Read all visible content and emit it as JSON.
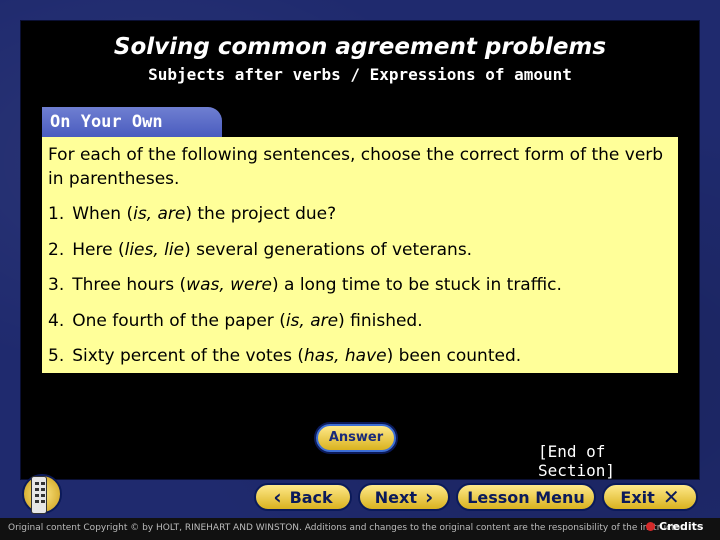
{
  "title": "Solving common agreement problems",
  "subtitle": "Subjects after verbs / Expressions of amount",
  "tab_label": "On Your Own",
  "instructions": "For each of the following sentences, choose the correct form of the verb in parentheses.",
  "items": [
    {
      "num": "1.",
      "before": "When (",
      "choices": "is, are",
      "after": ") the project due?"
    },
    {
      "num": "2.",
      "before": "Here (",
      "choices": "lies, lie",
      "after": ") several generations of veterans."
    },
    {
      "num": "3.",
      "before": "Three hours (",
      "choices": "was, were",
      "after": ") a long time to be stuck in traffic."
    },
    {
      "num": "4.",
      "before": "One fourth of the paper (",
      "choices": "is, are",
      "after": ") finished."
    },
    {
      "num": "5.",
      "before": "Sixty percent of the votes (",
      "choices": "has, have",
      "after": ") been counted."
    }
  ],
  "answer_label": "Answer",
  "end_section": "[End of Section]",
  "nav": {
    "back": "Back",
    "next": "Next",
    "lesson_menu": "Lesson Menu",
    "exit": "Exit"
  },
  "footer": {
    "copyright": "Original content Copyright © by HOLT, RINEHART AND WINSTON. Additions and changes to the original content are the responsibility of the instructor.",
    "credits": "Credits"
  },
  "colors": {
    "background": "#1f2a6e",
    "content_box": "#ffff99",
    "tab": "#5566c8",
    "button": "#f0c83a"
  }
}
